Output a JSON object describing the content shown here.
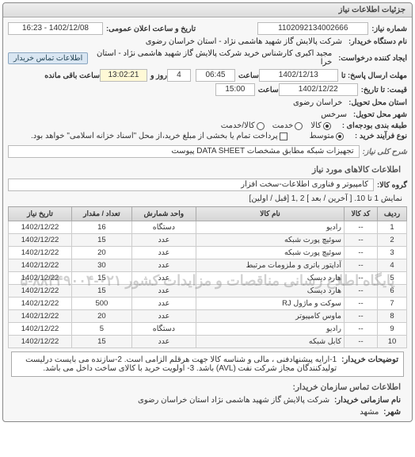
{
  "window_title": "جزئیات اطلاعات نیاز",
  "header": {
    "req_no_label": "شماره نیاز:",
    "req_no": "1102092134002666",
    "announce_label": "تاریخ و ساعت اعلان عمومی:",
    "announce_value": "1402/12/08 - 16:23",
    "org_label": "نام دستگاه خریدار:",
    "org_value": "شرکت پالایش گاز شهید هاشمی نژاد - استان خراسان رضوی",
    "requester_label": "ایجاد کننده درخواست:",
    "requester_value": "مجید اکبری کارشناس خرید شرکت پالایش گاز شهید هاشمی نژاد - استان خرا",
    "contact_btn": "اطلاعات تماس خریدار",
    "deadline_send_label": "مهلت ارسال پاسخ: تا",
    "deadline_date": "1402/12/13",
    "time_label": "ساعت",
    "deadline_time": "06:45",
    "days_left": "4",
    "days_left_label": "روز و",
    "time_left": "13:02:21",
    "time_left_label": "ساعت باقی مانده",
    "price_date_label": "قیمت: تا تاریخ:",
    "price_date": "1402/12/22",
    "price_time": "15:00",
    "delivery_prov_label": "استان محل تحویل:",
    "delivery_prov": "خراسان رضوی",
    "delivery_city_label": "شهر محل تحویل:",
    "delivery_city": "سرخس",
    "budget_label": "طبقه بندی بودجه‌ای :",
    "budget_options": [
      "کالا",
      "خدمت",
      "کالا/خدمت"
    ],
    "budget_selected": 0,
    "purchase_type_label": "نوع فرآیند خرید :",
    "purchase_options": [
      "متوسط"
    ],
    "purchase_note": "پرداخت تمام یا بخشی از مبلغ خرید،از محل \"اسناد خزانه اسلامی\" خواهد بود."
  },
  "need": {
    "title_label": "شرح کلی نیاز:",
    "title_value": "تجهیزات شبکه مطابق مشخصات DATA SHEET پیوست"
  },
  "goods_section": {
    "title": "اطلاعات کالاهای مورد نیاز",
    "group_label": "گروه کالا:",
    "group_value": "کامپیوتر و فناوری اطلاعات-سخت افزار",
    "pager_text": "نمایش 1 تا 10. [ آخرین / بعد ] 2 ,1 [قبل / اولین]",
    "columns": [
      "ردیف",
      "کد کالا",
      "نام کالا",
      "واحد شمارش",
      "تعداد / مقدار",
      "تاریخ نیاز"
    ],
    "rows": [
      {
        "n": "1",
        "code": "--",
        "name": "رادیو",
        "unit": "دستگاه",
        "qty": "16",
        "date": "1402/12/22"
      },
      {
        "n": "2",
        "code": "--",
        "name": "سوئیچ پورت شبکه",
        "unit": "عدد",
        "qty": "15",
        "date": "1402/12/22"
      },
      {
        "n": "3",
        "code": "--",
        "name": "سوئیچ پورت شبکه",
        "unit": "عدد",
        "qty": "20",
        "date": "1402/12/22"
      },
      {
        "n": "4",
        "code": "--",
        "name": "آداپتور باتری و ملزومات مرتبط",
        "unit": "عدد",
        "qty": "30",
        "date": "1402/12/22"
      },
      {
        "n": "5",
        "code": "--",
        "name": "هارد دیسک",
        "unit": "عدد",
        "qty": "15",
        "date": "1402/12/22"
      },
      {
        "n": "6",
        "code": "--",
        "name": "هارد دیسک",
        "unit": "عدد",
        "qty": "15",
        "date": "1402/12/22"
      },
      {
        "n": "7",
        "code": "--",
        "name": "سوکت و ماژول RJ",
        "unit": "عدد",
        "qty": "500",
        "date": "1402/12/22"
      },
      {
        "n": "8",
        "code": "--",
        "name": "ماوس کامپیوتر",
        "unit": "عدد",
        "qty": "20",
        "date": "1402/12/22"
      },
      {
        "n": "9",
        "code": "--",
        "name": "رادیو",
        "unit": "دستگاه",
        "qty": "5",
        "date": "1402/12/22"
      },
      {
        "n": "10",
        "code": "--",
        "name": "کابل شبکه",
        "unit": "عدد",
        "qty": "15",
        "date": "1402/12/22"
      }
    ],
    "watermark": "پایگاه اطلاع رسانی مناقصات و مزایدات کشور ۰۲۱-۸۸۳۴۹۰۰۴-۵"
  },
  "buyer_note": {
    "label": "توضیحات خریدار:",
    "text": "1-ارایه پیشنهادفنی ، مالی و شناسه کالا جهت هرقلم الزامی است. 2-سازنده می بایست درلیست تولیدکنندگان مجاز شرکت نفت (AVL) باشد. 3- اولویت خرید با کالای ساخت داخل می باشد."
  },
  "footer": {
    "section_title": "اطلاعات تماس سازمان خریدار:",
    "org_label": "نام سازمانی خریدار:",
    "org_value": "شرکت پالایش گاز شهید هاشمی نژاد استان خراسان رضوی",
    "city_label": "شهر:",
    "city_value": "مشهد"
  }
}
